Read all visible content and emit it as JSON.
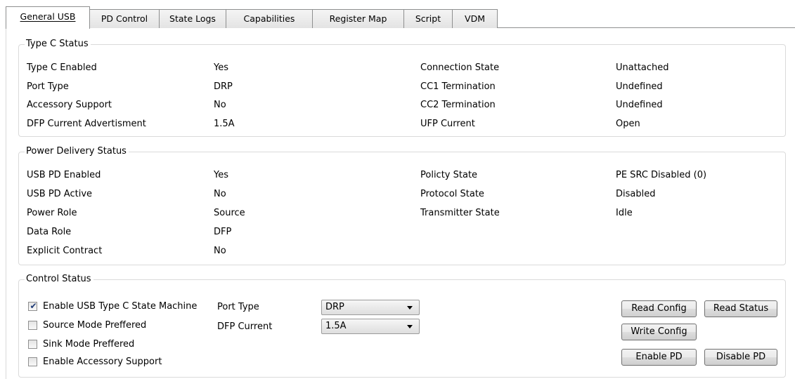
{
  "tabs": [
    {
      "label": "General USB"
    },
    {
      "label": "PD Control"
    },
    {
      "label": "State Logs"
    },
    {
      "label": "Capabilities"
    },
    {
      "label": "Register Map"
    },
    {
      "label": "Script"
    },
    {
      "label": "VDM"
    }
  ],
  "type_c_status": {
    "title": "Type C Status",
    "left": [
      {
        "label": "Type C Enabled",
        "value": "Yes"
      },
      {
        "label": "Port Type",
        "value": "DRP"
      },
      {
        "label": "Accessory Support",
        "value": "No"
      },
      {
        "label": "DFP Current Advertisment",
        "value": "1.5A"
      }
    ],
    "right": [
      {
        "label": "Connection State",
        "value": "Unattached"
      },
      {
        "label": "CC1 Termination",
        "value": "Undefined"
      },
      {
        "label": "CC2 Termination",
        "value": "Undefined"
      },
      {
        "label": "UFP Current",
        "value": "Open"
      }
    ]
  },
  "power_delivery_status": {
    "title": "Power Delivery Status",
    "left": [
      {
        "label": "USB PD Enabled",
        "value": "Yes"
      },
      {
        "label": "USB PD Active",
        "value": "No"
      },
      {
        "label": "Power Role",
        "value": "Source"
      },
      {
        "label": "Data Role",
        "value": "DFP"
      },
      {
        "label": "Explicit Contract",
        "value": "No"
      }
    ],
    "right": [
      {
        "label": "Policty State",
        "value": "PE SRC Disabled (0)"
      },
      {
        "label": "Protocol State",
        "value": "Disabled"
      },
      {
        "label": "Transmitter State",
        "value": "Idle"
      }
    ]
  },
  "control_status": {
    "title": "Control Status",
    "checkboxes": [
      {
        "label": "Enable USB Type C State Machine",
        "checked": true
      },
      {
        "label": "Source Mode Preffered",
        "checked": false
      },
      {
        "label": "Sink Mode Preffered",
        "checked": false
      },
      {
        "label": "Enable Accessory Support",
        "checked": false
      }
    ],
    "port_type_label": "Port Type",
    "port_type_value": "DRP",
    "dfp_current_label": "DFP Current",
    "dfp_current_value": "1.5A",
    "buttons": {
      "read_config": "Read Config",
      "read_status": "Read Status",
      "write_config": "Write Config",
      "enable_pd": "Enable PD",
      "disable_pd": "Disable PD"
    }
  },
  "icons": {
    "check": "checkmark-icon",
    "dropdown": "chevron-down-icon"
  }
}
